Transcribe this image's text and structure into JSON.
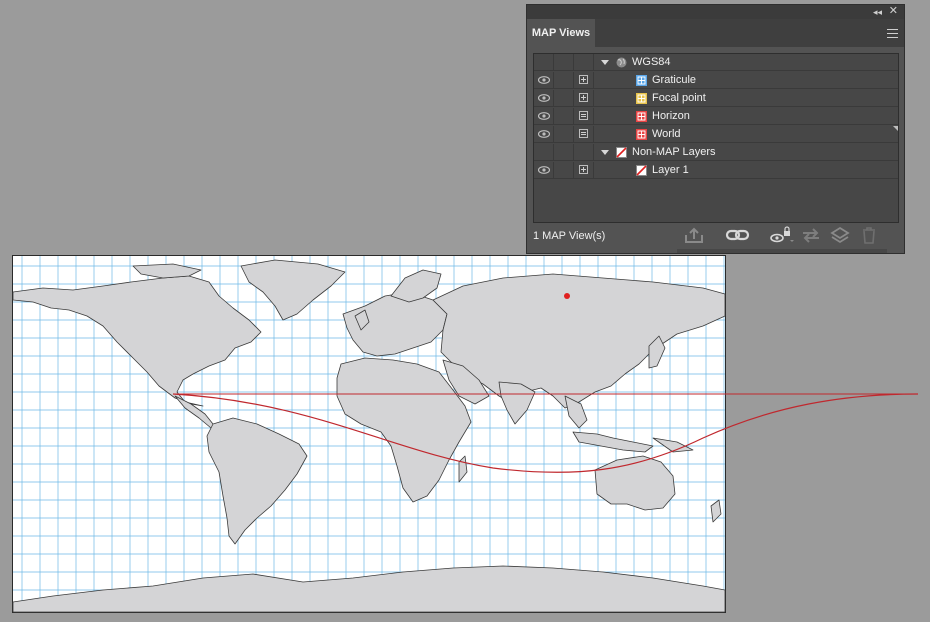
{
  "panel": {
    "title": "MAP Views",
    "footer_count": "1 MAP View(s)",
    "icons": {
      "collapse": "double-chevron-left-icon",
      "close": "close-icon",
      "menu": "hamburger-menu-icon",
      "export": "export-icon",
      "link": "link-icon",
      "visibility_lock": "eye-lock-icon",
      "swap": "swap-arrows-icon",
      "layers": "layers-icon",
      "delete": "trash-icon"
    }
  },
  "layers": [
    {
      "id": "wgs84",
      "label": "WGS84",
      "group": true,
      "icon": "globe-icon",
      "visible": null,
      "expand": null
    },
    {
      "id": "graticule",
      "label": "Graticule",
      "group": false,
      "icon": "graticule-icon",
      "icon_color": "#5aa6e8",
      "visible": true,
      "expand": "plus"
    },
    {
      "id": "focal-point",
      "label": "Focal point",
      "group": false,
      "icon": "focal-point-icon",
      "icon_color": "#e8c34a",
      "visible": true,
      "expand": "plus"
    },
    {
      "id": "horizon",
      "label": "Horizon",
      "group": false,
      "icon": "horizon-icon",
      "icon_color": "#e84444",
      "visible": true,
      "expand": "doc"
    },
    {
      "id": "world",
      "label": "World",
      "group": false,
      "icon": "world-layer-icon",
      "icon_color": "#e84444",
      "visible": true,
      "expand": "doc"
    },
    {
      "id": "non-map",
      "label": "Non-MAP Layers",
      "group": true,
      "icon": "non-map-layer-icon",
      "visible": null,
      "expand": null
    },
    {
      "id": "layer-1",
      "label": "Layer 1",
      "group": false,
      "icon": "non-map-layer-icon",
      "visible": true,
      "expand": "plus"
    }
  ],
  "map": {
    "graticule_color": "#6db8e6",
    "land_color": "#d4d4d6",
    "outline_color": "#3a3a3a",
    "curve_color": "#c0282e",
    "focal_point_color": "#e02020",
    "graticule_step_deg": 10
  }
}
